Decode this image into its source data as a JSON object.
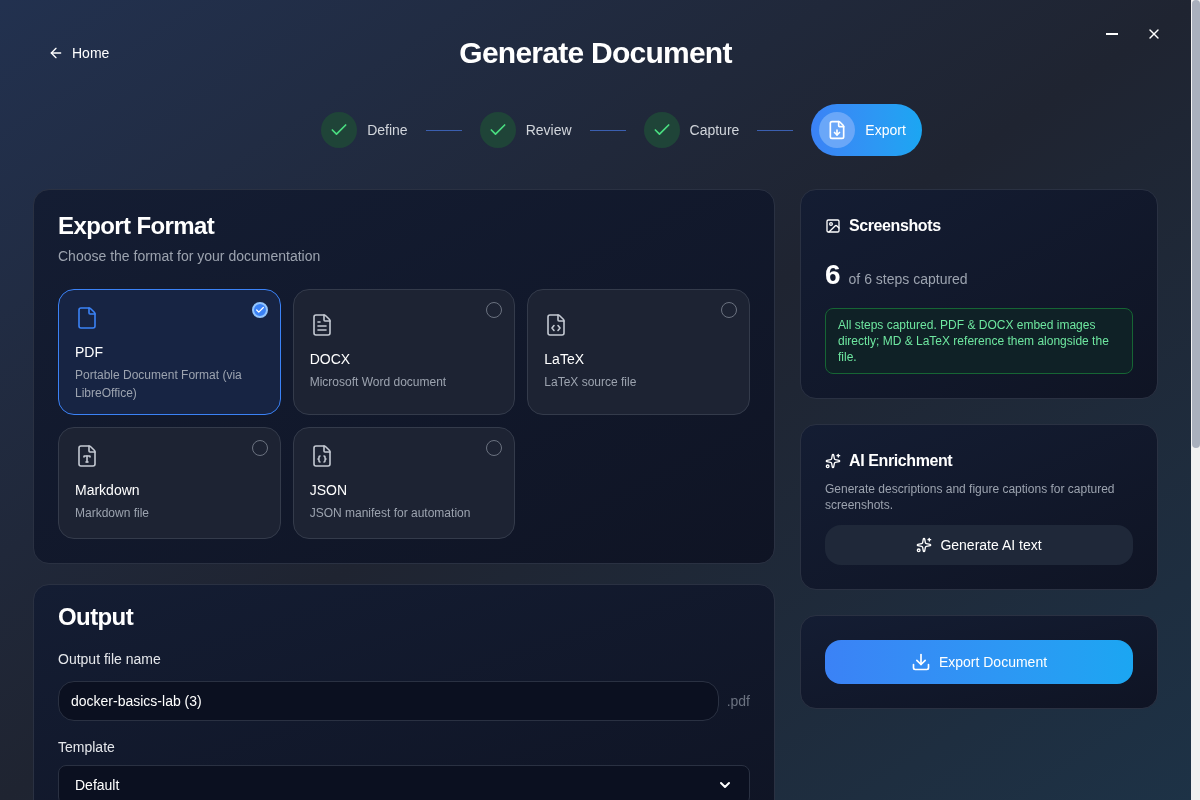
{
  "header": {
    "back_link": "Home",
    "title": "Generate Document"
  },
  "steps": [
    {
      "label": "Define",
      "kind": "done",
      "selected": false
    },
    {
      "label": "Review",
      "kind": "done",
      "selected": false
    },
    {
      "label": "Capture",
      "kind": "done",
      "selected": false
    },
    {
      "label": "Export",
      "kind": "current",
      "selected": true
    }
  ],
  "export_format": {
    "title": "Export Format",
    "subtitle": "Choose the format for your documentation",
    "formats": [
      {
        "kind": "pdf",
        "name": "PDF",
        "description": "Portable Document Format (via LibreOffice)",
        "selected": true
      },
      {
        "kind": "docx",
        "name": "DOCX",
        "description": "Microsoft Word document",
        "selected": false
      },
      {
        "kind": "latex",
        "name": "LaTeX",
        "description": "LaTeX source file",
        "selected": false
      },
      {
        "kind": "markdown",
        "name": "Markdown",
        "description": "Markdown file",
        "selected": false
      },
      {
        "kind": "json",
        "name": "JSON",
        "description": "JSON manifest for automation",
        "selected": false
      }
    ]
  },
  "output": {
    "title": "Output",
    "file_name_label": "Output file name",
    "file_name": "docker-basics-lab (3)",
    "extension": ".pdf",
    "template_label": "Template",
    "template": "Default"
  },
  "screenshots": {
    "title": "Screenshots",
    "count": "6",
    "caption": "of 6 steps captured",
    "notice": "All steps captured. PDF & DOCX embed images directly; MD & LaTeX reference them alongside the file."
  },
  "ai_enrichment": {
    "title": "AI Enrichment",
    "description": "Generate descriptions and figure captions for captured screenshots.",
    "button": "Generate AI text"
  },
  "export_button": "Export Document"
}
